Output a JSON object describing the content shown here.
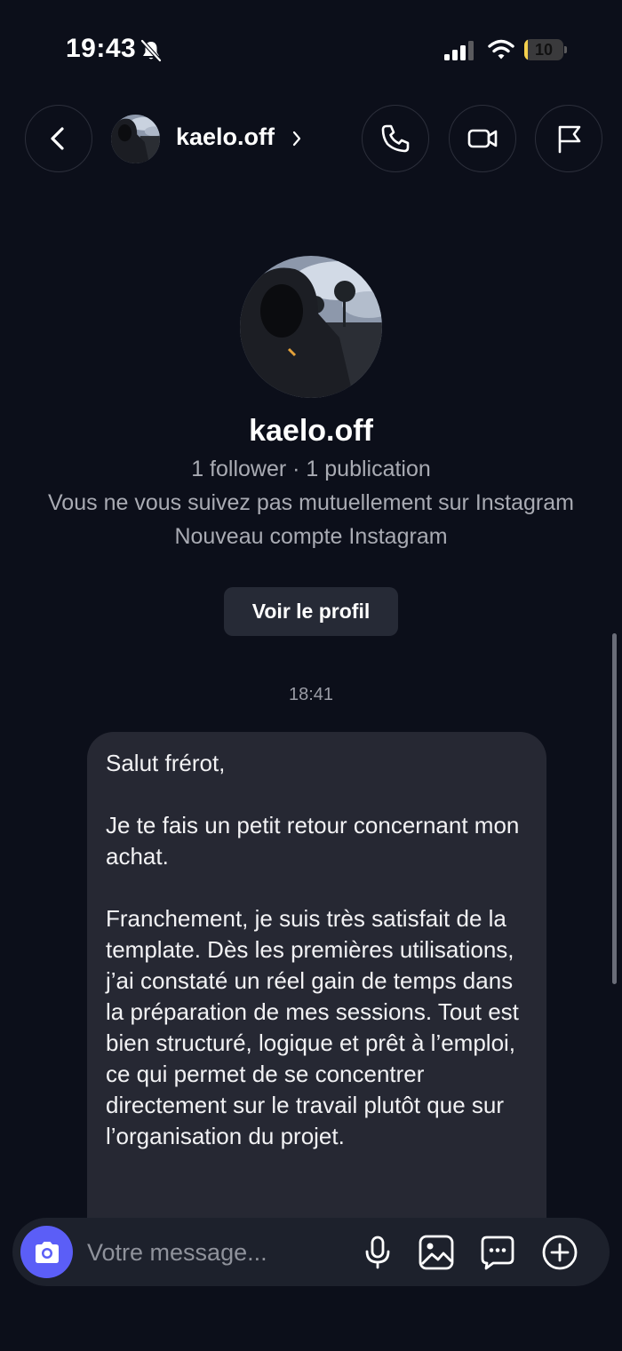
{
  "status_bar": {
    "time": "19:43",
    "battery_level": "10",
    "battery_fraction": 0.1,
    "battery_color": "#f4d04d"
  },
  "header": {
    "username": "kaelo.off",
    "icons": {
      "back": "chevron-left-icon",
      "call": "phone-icon",
      "video": "video-camera-icon",
      "report": "flag-icon"
    }
  },
  "profile": {
    "username": "kaelo.off",
    "stats": "1 follower · 1 publication",
    "mutual_note": "Vous ne vous suivez pas mutuellement sur Instagram",
    "account_note": "Nouveau compte Instagram",
    "view_profile_label": "Voir le profil"
  },
  "conversation": {
    "timestamp": "18:41",
    "message": {
      "paragraphs": [
        "Salut frérot,",
        "Je te fais un petit retour concernant mon achat.",
        "Franchement, je suis très satisfait de la template. Dès les premières utilisations, j’ai constaté un réel gain de temps dans la préparation de mes sessions. Tout est bien structuré, logique et prêt à l’emploi, ce qui permet de se concentrer directement sur le travail plutôt que sur l’organisation du projet."
      ]
    }
  },
  "composer": {
    "placeholder": "Votre message...",
    "accent_color": "#5b5ef7",
    "icons": [
      "camera-icon",
      "microphone-icon",
      "image-icon",
      "sticker-icon",
      "plus-icon"
    ]
  }
}
